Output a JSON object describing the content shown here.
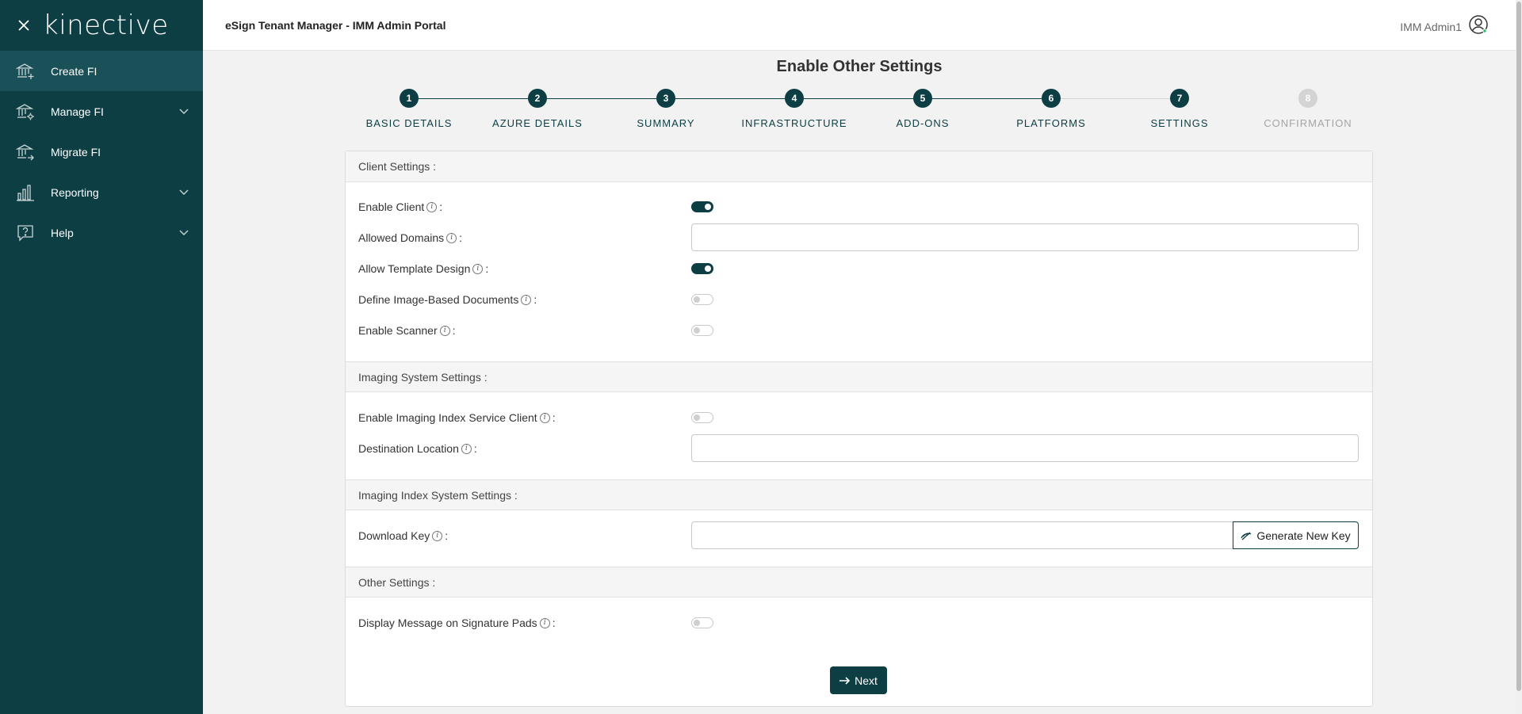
{
  "sidebar": {
    "logo": "kinective",
    "items": [
      {
        "label": "Create FI",
        "icon": "bank-plus-icon",
        "active": true
      },
      {
        "label": "Manage FI",
        "icon": "bank-gear-icon",
        "expandable": true
      },
      {
        "label": "Migrate FI",
        "icon": "bank-arrow-icon"
      },
      {
        "label": "Reporting",
        "icon": "bar-chart-icon",
        "expandable": true
      },
      {
        "label": "Help",
        "icon": "help-icon",
        "expandable": true
      }
    ]
  },
  "header": {
    "title": "eSign Tenant Manager - IMM Admin Portal",
    "user_name": "IMM Admin1"
  },
  "page": {
    "title": "Enable Other Settings"
  },
  "stepper": {
    "steps": [
      {
        "num": "1",
        "label": "BASIC DETAILS",
        "state": "complete"
      },
      {
        "num": "2",
        "label": "AZURE DETAILS",
        "state": "complete"
      },
      {
        "num": "3",
        "label": "SUMMARY",
        "state": "complete"
      },
      {
        "num": "4",
        "label": "INFRASTRUCTURE",
        "state": "complete"
      },
      {
        "num": "5",
        "label": "ADD-ONS",
        "state": "complete"
      },
      {
        "num": "6",
        "label": "PLATFORMS",
        "state": "complete"
      },
      {
        "num": "7",
        "label": "SETTINGS",
        "state": "current"
      },
      {
        "num": "8",
        "label": "CONFIRMATION",
        "state": "pending"
      }
    ]
  },
  "client_settings": {
    "header": "Client Settings :",
    "enable_client": {
      "label": "Enable Client",
      "on": true
    },
    "allowed_domains": {
      "label": "Allowed Domains",
      "value": ""
    },
    "allow_template_design": {
      "label": "Allow Template Design",
      "on": true
    },
    "define_image_docs": {
      "label": "Define Image-Based Documents",
      "on": false
    },
    "enable_scanner": {
      "label": "Enable Scanner",
      "on": false
    }
  },
  "imaging_system": {
    "header": "Imaging System Settings :",
    "enable_imaging_index": {
      "label": "Enable Imaging Index Service Client",
      "on": false
    },
    "destination_location": {
      "label": "Destination Location",
      "value": ""
    }
  },
  "imaging_index_system": {
    "header": "Imaging Index System Settings :",
    "download_key": {
      "label": "Download Key",
      "value": ""
    },
    "generate_button": "Generate New Key"
  },
  "other_settings": {
    "header": "Other Settings :",
    "display_message": {
      "label": "Display Message on Signature Pads",
      "on": false
    }
  },
  "common": {
    "info_glyph": "i",
    "colon": ":"
  },
  "actions": {
    "next_label": "Next"
  },
  "colors": {
    "brand_dark": "#0c3e44",
    "pending_step": "#d4d4d4"
  }
}
